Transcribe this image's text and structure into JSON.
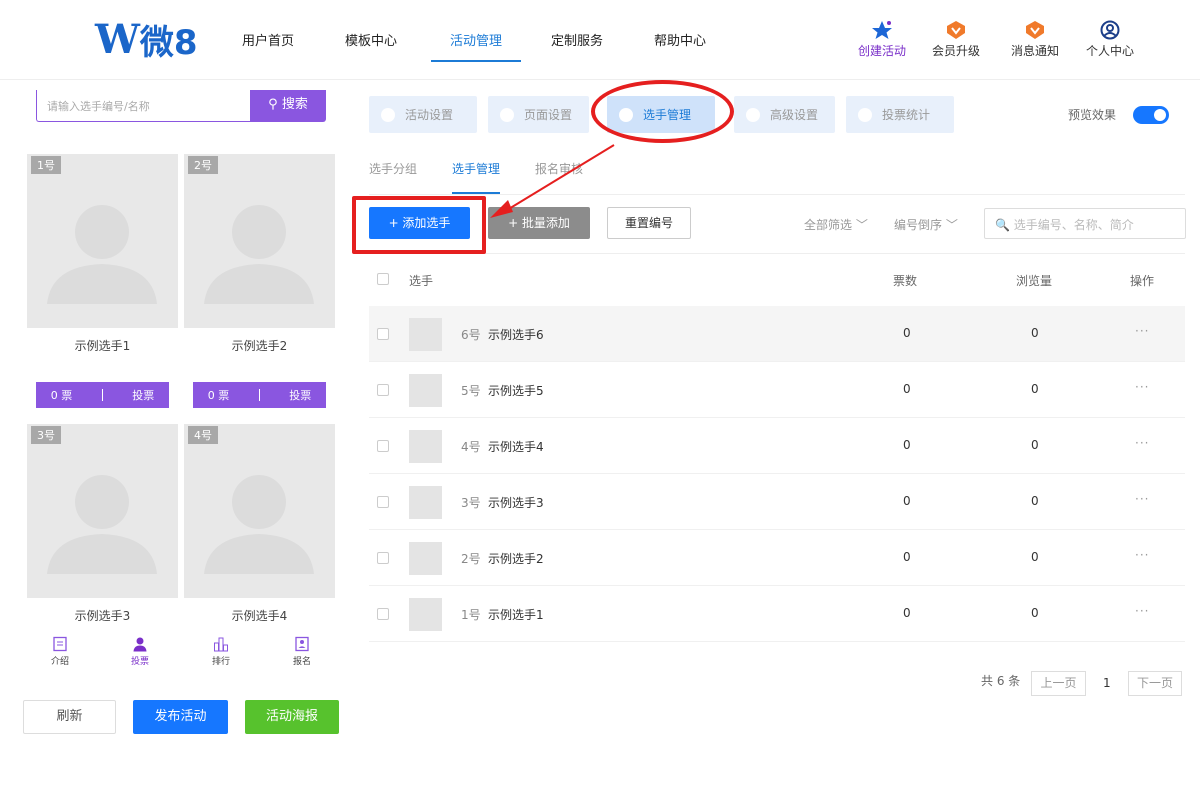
{
  "header": {
    "logo_w": "W",
    "logo_text": "微8",
    "nav": [
      {
        "label": "用户首页"
      },
      {
        "label": "模板中心"
      },
      {
        "label": "活动管理"
      },
      {
        "label": "定制服务"
      },
      {
        "label": "帮助中心"
      }
    ],
    "tools": [
      {
        "label": "创建活动",
        "icon": "star-icon"
      },
      {
        "label": "会员升级",
        "icon": "vip-badge-icon"
      },
      {
        "label": "消息通知",
        "icon": "bell-badge-icon"
      },
      {
        "label": "个人中心",
        "icon": "user-circle-icon"
      }
    ]
  },
  "left": {
    "search_placeholder": "请输入选手编号/名称",
    "search_button": "搜索",
    "cards": [
      {
        "num": "1号",
        "name": "示例选手1",
        "votes": "0 票",
        "vote_btn": "投票"
      },
      {
        "num": "2号",
        "name": "示例选手2",
        "votes": "0 票",
        "vote_btn": "投票"
      },
      {
        "num": "3号",
        "name": "示例选手3"
      },
      {
        "num": "4号",
        "name": "示例选手4"
      }
    ],
    "mobile_tabs": [
      {
        "label": "介绍",
        "icon": "document-icon"
      },
      {
        "label": "投票",
        "icon": "user-icon"
      },
      {
        "label": "排行",
        "icon": "chart-icon"
      },
      {
        "label": "报名",
        "icon": "signup-icon"
      }
    ],
    "buttons": {
      "refresh": "刷新",
      "publish": "发布活动",
      "poster": "活动海报"
    }
  },
  "steps": [
    {
      "label": "活动设置"
    },
    {
      "label": "页面设置"
    },
    {
      "label": "选手管理"
    },
    {
      "label": "高级设置"
    },
    {
      "label": "投票统计"
    }
  ],
  "preview_label": "预览效果",
  "subtabs": [
    {
      "label": "选手分组"
    },
    {
      "label": "选手管理"
    },
    {
      "label": "报名审核"
    }
  ],
  "toolbar": {
    "add": "+ 添加选手",
    "batch": "+ 批量添加",
    "reset": "重置编号",
    "filter_all": "全部筛选 ﹀",
    "sort": "编号倒序 ﹀",
    "search_placeholder": "🔍 选手编号、名称、简介"
  },
  "table": {
    "headers": {
      "player": "选手",
      "votes": "票数",
      "views": "浏览量",
      "actions": "操作"
    },
    "rows": [
      {
        "num": "6号",
        "name": "示例选手6",
        "votes": "0",
        "views": "0",
        "more": "···"
      },
      {
        "num": "5号",
        "name": "示例选手5",
        "votes": "0",
        "views": "0",
        "more": "···"
      },
      {
        "num": "4号",
        "name": "示例选手4",
        "votes": "0",
        "views": "0",
        "more": "···"
      },
      {
        "num": "3号",
        "name": "示例选手3",
        "votes": "0",
        "views": "0",
        "more": "···"
      },
      {
        "num": "2号",
        "name": "示例选手2",
        "votes": "0",
        "views": "0",
        "more": "···"
      },
      {
        "num": "1号",
        "name": "示例选手1",
        "votes": "0",
        "views": "0",
        "more": "···"
      }
    ]
  },
  "pager": {
    "total": "共 6 条",
    "prev": "上一页",
    "current": "1",
    "next": "下一页"
  },
  "colors": {
    "primary": "#1677ff",
    "purple": "#8a56e0",
    "green": "#57c22d",
    "annotation": "#e51f1f"
  }
}
